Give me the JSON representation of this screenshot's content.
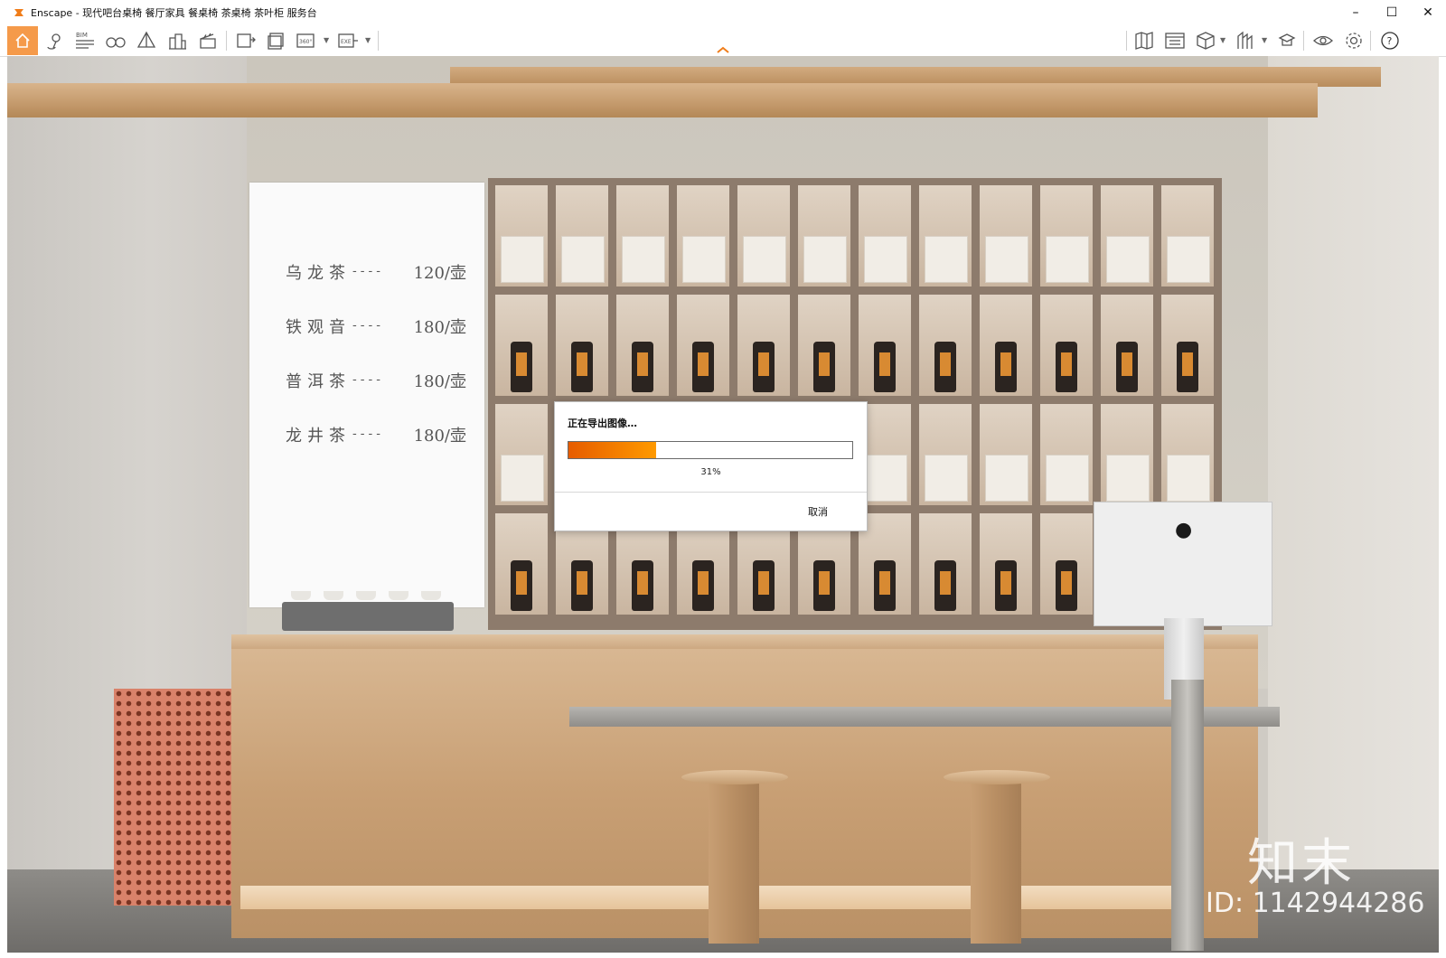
{
  "window": {
    "title": "Enscape - 现代吧台桌椅 餐厅家具 餐桌椅 茶桌椅 茶叶柜 服务台",
    "controls": {
      "minimize": "–",
      "maximize": "☐",
      "close": "✕"
    },
    "accent": "#f59a4a"
  },
  "toolbar": {
    "left_icons": [
      "home-icon",
      "location-pin-icon",
      "bim-icon",
      "binoculars-icon",
      "pyramid-icon",
      "buildings-icon",
      "clapperboard-icon",
      "screenshot-icon",
      "batch-render-icon",
      "panorama-360-icon",
      "export-exe-icon"
    ],
    "bim_label": "BIM",
    "pano_label": "360°",
    "exe_label": "EXE",
    "right_icons": [
      "map-icon",
      "asset-library-icon",
      "cube-view-icon",
      "assets-icon",
      "hat-icon",
      "visual-settings-eye-icon",
      "settings-gear-icon",
      "help-icon"
    ],
    "help_label": "?"
  },
  "menu_board": {
    "items": [
      {
        "name": "乌龙茶",
        "dash": "----",
        "price": "120/壶"
      },
      {
        "name": "铁观音",
        "dash": "----",
        "price": "180/壶"
      },
      {
        "name": "普洱茶",
        "dash": "----",
        "price": "180/壶"
      },
      {
        "name": "龙井茶",
        "dash": "----",
        "price": "180/壶"
      }
    ]
  },
  "dialog": {
    "title": "正在导出图像…",
    "progress": 31,
    "progress_text": "31%",
    "cancel_label": "取消",
    "progress_color": "#ff8c00"
  },
  "watermark": {
    "mark": "知末",
    "id": "ID: 1142944286"
  }
}
